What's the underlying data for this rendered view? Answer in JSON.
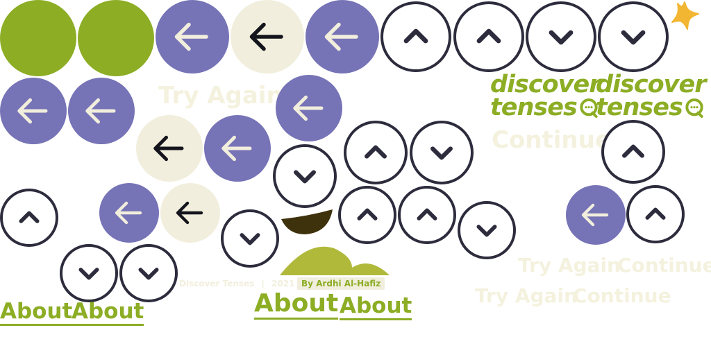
{
  "brand": {
    "logo_line1": "discover",
    "logo_line2": "tenses"
  },
  "buttons": {
    "try_again": "Try Again",
    "continue": "Continue",
    "about": "About"
  },
  "footer": {
    "title": "Discover Tenses",
    "separator": "|",
    "year": "2021",
    "author": "By Ardhi Al-Hafiz"
  },
  "colors": {
    "green": "#8cad24",
    "purple": "#7673b6",
    "cream": "#f1eedd",
    "dark": "#2d2c3d",
    "star": "#f2b632"
  },
  "icons": [
    "arrow-left-icon",
    "chevron-up-icon",
    "chevron-down-icon",
    "star-icon",
    "chat-bubble-icon"
  ]
}
